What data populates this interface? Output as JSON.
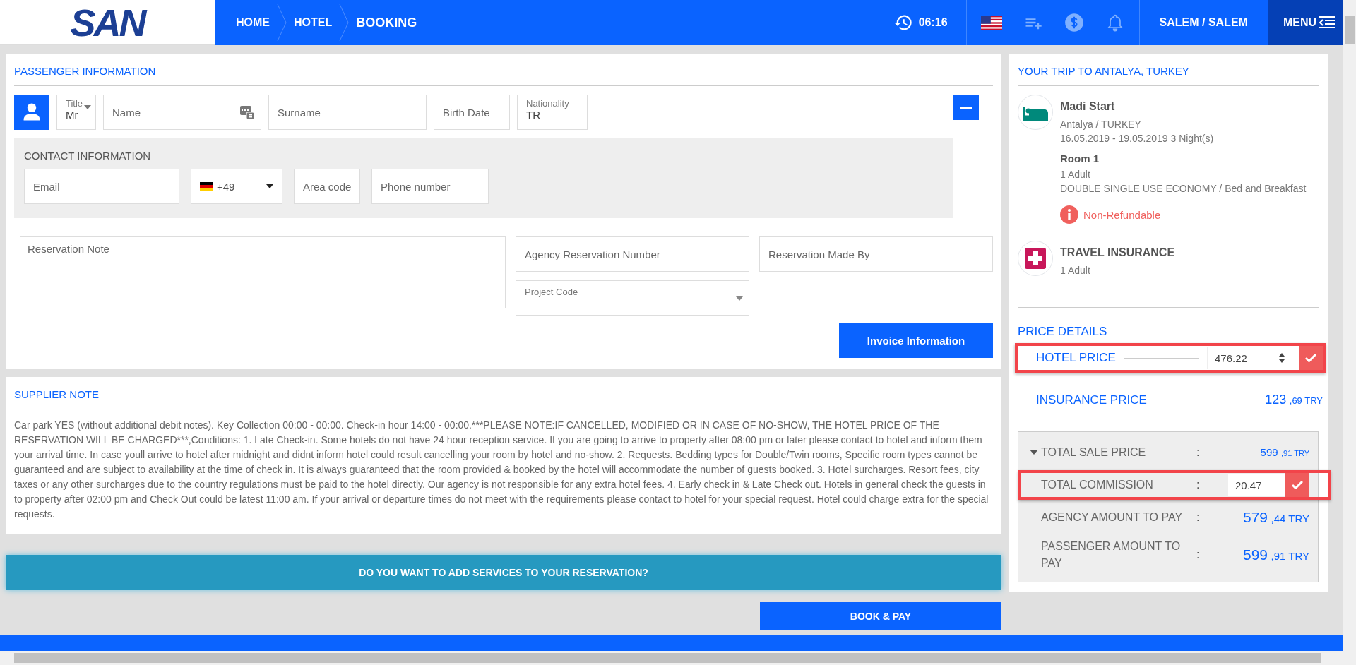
{
  "header": {
    "logo": "SAN",
    "breadcrumbs": [
      "HOME",
      "HOTEL",
      "BOOKING"
    ],
    "time": "06:16",
    "user": "SALEM / SALEM",
    "menu": "MENU"
  },
  "passenger": {
    "title": "PASSENGER INFORMATION",
    "title_select": {
      "label": "Title",
      "value": "Mr"
    },
    "name_placeholder": "Name",
    "surname_placeholder": "Surname",
    "birth_placeholder": "Birth Date",
    "nationality": {
      "label": "Nationality",
      "value": "TR"
    }
  },
  "contact": {
    "title": "CONTACT INFORMATION",
    "email_placeholder": "Email",
    "phone_code": "+49",
    "area_placeholder": "Area code",
    "phone_placeholder": "Phone number"
  },
  "reservation": {
    "note_placeholder": "Reservation Note",
    "agency_number_placeholder": "Agency Reservation Number",
    "made_by_placeholder": "Reservation Made By",
    "project_code_label": "Project Code",
    "invoice_button": "Invoice Information"
  },
  "supplier_note": {
    "title": "SUPPLIER NOTE",
    "text": "Car park YES (without additional debit notes). Key Collection 00:00 - 00:00. Check-in hour 14:00 - 00:00.***PLEASE NOTE:IF CANCELLED, MODIFIED OR IN CASE OF NO-SHOW, THE HOTEL PRICE OF THE RESERVATION WILL BE CHARGED***,Conditions: 1. Late Check-in. Some hotels do not have 24 hour reception service. If you are going to arrive to property after 08:00 pm or later please contact to hotel and inform them your arrival time. In case youll arrive to hotel after midnight and didnt inform hotel could result cancelling your room by hotel and no-show. 2. Requests. Bedding types for Double/Twin rooms, Specific room types cannot be guaranteed and are subject to availability at the time of check in. It is always guaranteed that the room provided & booked by the hotel will accommodate the number of guests booked. 3. Hotel surcharges. Resort fees, city taxes or any other surcharges due to the country regulations must be paid to the hotel directly. Our agency is not responsible for any extra hotel fees. 4. Early check in & Late Check out. Hotels in general check the guests in to property after 02:00 pm and Check Out could be latest 11:00 am. If your arrival or departure times do not meet with the requirements please contact to hotel for your special request. Hotel could charge extra for the special requests."
  },
  "add_services_button": "DO YOU WANT TO ADD SERVICES TO YOUR RESERVATION?",
  "book_button": "BOOK & PAY",
  "trip": {
    "title": "YOUR TRIP TO ANTALYA, TURKEY",
    "items": [
      {
        "kind": "hotel",
        "name": "Madi Start",
        "lines": [
          "Antalya / TURKEY",
          "16.05.2019 - 19.05.2019 3 Night(s)"
        ],
        "room": "Room 1",
        "room_lines": [
          "1 Adult",
          "DOUBLE SINGLE USE ECONOMY / Bed and Breakfast"
        ],
        "policy": "Non-Refundable"
      },
      {
        "kind": "insurance",
        "name": "TRAVEL INSURANCE",
        "lines": [
          "1 Adult"
        ]
      }
    ]
  },
  "price": {
    "title": "PRICE DETAILS",
    "hotel_price": {
      "label": "HOTEL PRICE",
      "value": "476.22",
      "highlighted": true
    },
    "insurance_price": {
      "label": "INSURANCE PRICE",
      "amount": "123",
      "fraction": ",69",
      "currency": "TRY"
    },
    "summary": {
      "rows": [
        {
          "kind": "subtotal",
          "label": "TOTAL SALE PRICE",
          "separator": ":",
          "amount": "599",
          "fraction": ",91",
          "currency": "TRY",
          "expanded": true
        },
        {
          "kind": "input",
          "label": "TOTAL COMMISSION",
          "separator": ":",
          "value": "20.47",
          "highlighted": true
        },
        {
          "kind": "amount",
          "label": "AGENCY AMOUNT TO PAY",
          "separator": ":",
          "amount": "579",
          "fraction": ",44",
          "currency": "TRY"
        },
        {
          "kind": "amount",
          "label": "PASSENGER AMOUNT TO PAY",
          "separator": ":",
          "amount": "599",
          "fraction": ",91",
          "currency": "TRY"
        }
      ]
    }
  }
}
